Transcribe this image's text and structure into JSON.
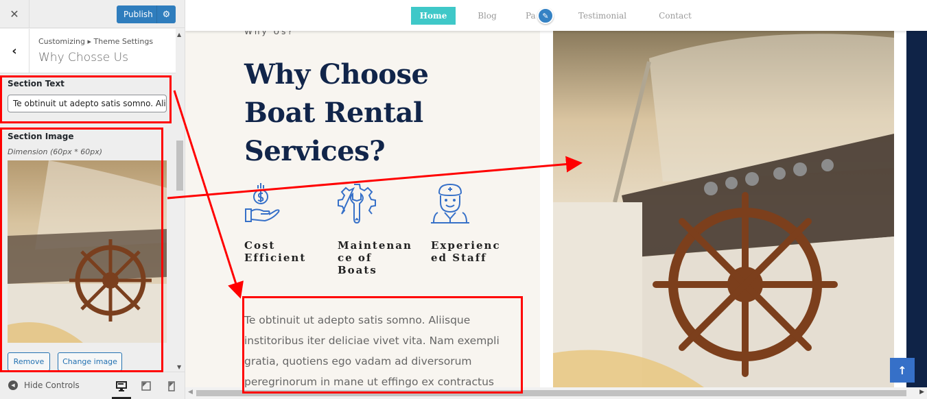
{
  "customizer": {
    "close_label": "✕",
    "publish_label": "Publish",
    "settings_icon": "gear-icon",
    "back_icon": "chevron-left-icon",
    "breadcrumb": "Customizing ▸ Theme Settings",
    "panel_title": "Why Chosse Us",
    "section_text": {
      "label": "Section Text",
      "value": "Te obtinuit ut adepto satis somno. Aliisque institoribus iter deliciae vivet vita."
    },
    "section_image": {
      "label": "Section Image",
      "dimension_note": "Dimension (60px * 60px)",
      "remove_label": "Remove",
      "change_label": "Change image"
    },
    "footer": {
      "hide_controls_label": "Hide Controls",
      "devices": [
        "desktop",
        "tablet",
        "mobile"
      ],
      "active_device": "desktop"
    }
  },
  "preview": {
    "nav": {
      "items": [
        {
          "label": "Home",
          "active": true
        },
        {
          "label": "Blog",
          "active": false
        },
        {
          "label": "Pa",
          "active": false
        },
        {
          "label": "Testimonial",
          "active": false
        },
        {
          "label": "Contact",
          "active": false
        }
      ],
      "accent": "#3fc8c8"
    },
    "eyebrow": "Why Us?",
    "headline_lines": [
      "Why Choose",
      "Boat Rental",
      "Services?"
    ],
    "features": [
      {
        "icon": "money-hand-icon",
        "label_lines": [
          "Cost",
          "Efficient"
        ]
      },
      {
        "icon": "wrench-gear-icon",
        "label_lines": [
          "Maintenan",
          "ce of",
          "Boats"
        ]
      },
      {
        "icon": "captain-icon",
        "label_lines": [
          "Experienc",
          "ed Staff"
        ]
      }
    ],
    "body_text": "Te obtinuit ut adepto satis somno. Aliisque institoribus iter deliciae vivet vita. Nam exempli gratia, quotiens ego vadam ad diversorum peregrinorum in mane ut effingo ex contractus",
    "scroll_top_icon": "arrow-up-icon",
    "colors": {
      "headline": "#11254a",
      "icon": "#3670c8",
      "navy_strip": "#0f2347",
      "annotation": "#ff0000"
    }
  }
}
